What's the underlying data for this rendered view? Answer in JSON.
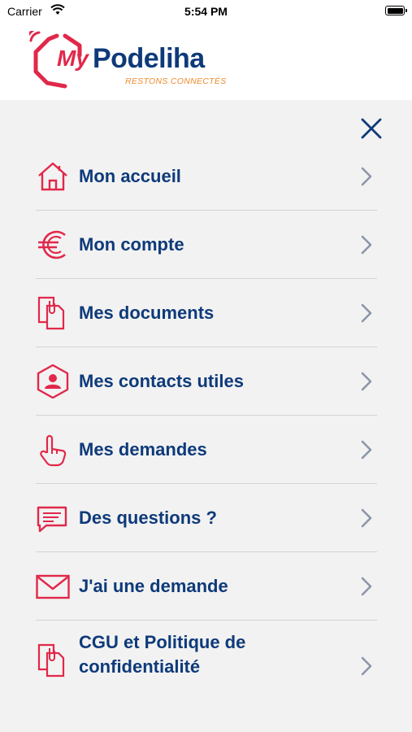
{
  "status_bar": {
    "carrier": "Carrier",
    "time": "5:54 PM"
  },
  "logo": {
    "my": "My",
    "name": "Podeliha",
    "tagline": "RESTONS CONNECTÉS"
  },
  "colors": {
    "brand_blue": "#0e3a7a",
    "brand_red": "#e1284a",
    "tagline_orange": "#ef8a2c",
    "background": "#f2f2f2"
  },
  "close_icon": "close-icon",
  "menu": {
    "items": [
      {
        "label": "Mon accueil",
        "icon": "home-icon"
      },
      {
        "label": "Mon compte",
        "icon": "euro-icon"
      },
      {
        "label": "Mes documents",
        "icon": "documents-icon"
      },
      {
        "label": "Mes contacts utiles",
        "icon": "contact-icon"
      },
      {
        "label": "Mes demandes",
        "icon": "hand-pointer-icon"
      },
      {
        "label": "Des questions ?",
        "icon": "chat-bubble-icon"
      },
      {
        "label": "J'ai une demande",
        "icon": "envelope-icon"
      },
      {
        "label": "CGU et Politique de confidentialité",
        "icon": "documents-icon"
      }
    ]
  }
}
